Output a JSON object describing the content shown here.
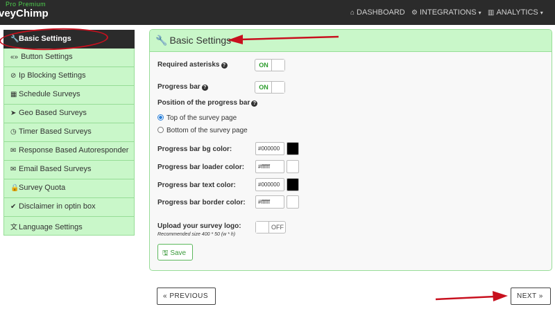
{
  "brand": {
    "subtitle": "Pro Premium",
    "name": "veyChimp"
  },
  "nav": [
    {
      "icon": "home-icon",
      "label": "DASHBOARD",
      "caret": ""
    },
    {
      "icon": "gears-icon",
      "label": "INTEGRATIONS",
      "caret": "▾"
    },
    {
      "icon": "bar-chart-icon",
      "label": "ANALYTICS",
      "caret": "▾"
    }
  ],
  "sidebar": {
    "items": [
      {
        "icon": "wrench-icon",
        "glyph": "🔧",
        "label": "Basic Settings"
      },
      {
        "icon": "brackets-icon",
        "glyph": "«»",
        "label": "Button Settings"
      },
      {
        "icon": "ban-icon",
        "glyph": "⊘",
        "label": "Ip Blocking Settings"
      },
      {
        "icon": "calendar-icon",
        "glyph": "▦",
        "label": "Schedule Surveys"
      },
      {
        "icon": "location-arrow-icon",
        "glyph": "➤",
        "label": "Geo Based Surveys"
      },
      {
        "icon": "clock-icon",
        "glyph": "◷",
        "label": "Timer Based Surveys"
      },
      {
        "icon": "envelope-icon",
        "glyph": "✉",
        "label": "Response Based Autoresponder"
      },
      {
        "icon": "envelope-outline-icon",
        "glyph": "✉",
        "label": "Email Based Surveys"
      },
      {
        "icon": "lock-icon",
        "glyph": "🔒",
        "label": "Survey Quota"
      },
      {
        "icon": "check-icon",
        "glyph": "✔",
        "label": "Disclaimer in optin box"
      },
      {
        "icon": "language-icon",
        "glyph": "文",
        "label": "Language Settings"
      }
    ]
  },
  "panel": {
    "title": "Basic Settings",
    "required_asterisks": {
      "label": "Required asterisks",
      "state": "ON"
    },
    "progress_bar": {
      "label": "Progress bar",
      "state": "ON"
    },
    "position": {
      "label": "Position of the progress bar",
      "options": [
        "Top of the survey page",
        "Bottom of the survey page"
      ],
      "selected": 0
    },
    "colors": [
      {
        "label": "Progress bar bg color:",
        "value": "#000000",
        "swatch": "#000000"
      },
      {
        "label": "Progress bar loader color:",
        "value": "#ffffff",
        "swatch": "#ffffff"
      },
      {
        "label": "Progress bar text color:",
        "value": "#000000",
        "swatch": "#000000"
      },
      {
        "label": "Progress bar border color:",
        "value": "#ffffff",
        "swatch": "#ffffff"
      }
    ],
    "logo": {
      "label": "Upload your survey logo:",
      "hint": "Recommended size 400 * 50 (w * h)",
      "state": "OFF"
    },
    "save_label": "Save"
  },
  "pager": {
    "previous": "« PREVIOUS",
    "next": "NEXT »"
  },
  "theme": {
    "accent_green": "#c9f7c9",
    "topbar": "#2b2b2b",
    "annotation_red": "#c8101e"
  }
}
